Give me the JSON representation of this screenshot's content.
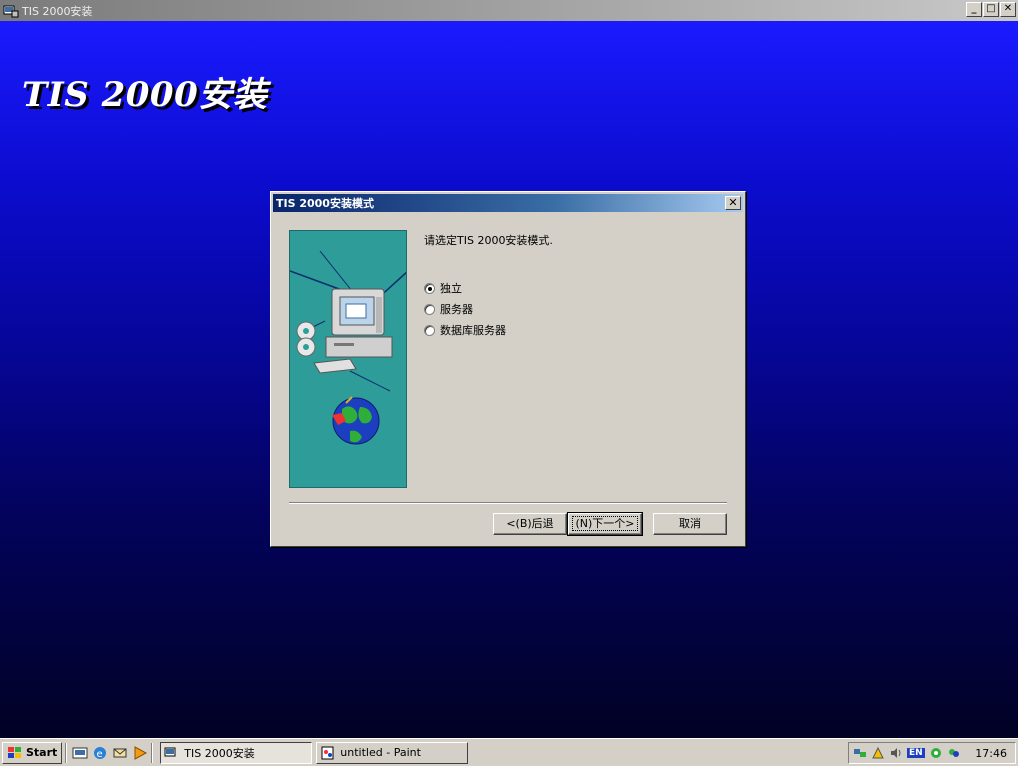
{
  "window": {
    "title": "TIS 2000安装",
    "minimize": "_",
    "maximize": "□",
    "close": "✕"
  },
  "backdrop": {
    "title": "TIS 2000安装"
  },
  "dialog": {
    "title": "TIS 2000安装模式",
    "close": "✕",
    "prompt": "请选定TIS 2000安装模式.",
    "options": [
      {
        "label": "独立",
        "checked": true
      },
      {
        "label": "服务器",
        "checked": false
      },
      {
        "label": "数据库服务器",
        "checked": false
      }
    ],
    "buttons": {
      "back": "<(B)后退",
      "next": "(N)下一个>",
      "cancel": "取消"
    }
  },
  "taskbar": {
    "start": "Start",
    "tasks": [
      {
        "label": "TIS 2000安装",
        "active": true
      },
      {
        "label": "untitled - Paint",
        "active": false
      }
    ],
    "tray_lang": "EN",
    "clock": "17:46"
  },
  "colors": {
    "accent": "#0a246a",
    "backdrop_top": "#1a1aff",
    "panel": "#2e9c98"
  }
}
